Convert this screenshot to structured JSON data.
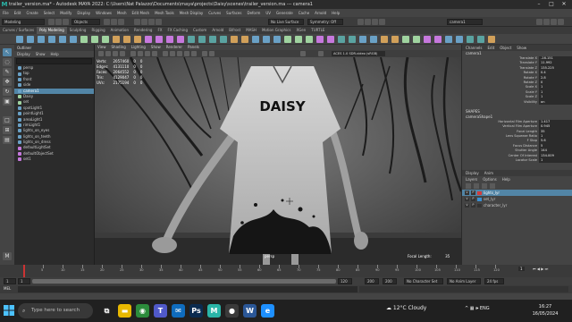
{
  "window": {
    "app_icon": "maya-icon",
    "title": "trailer_version.ma* - Autodesk MAYA 2022: C:\\Users\\Nat Palazzo\\Documents\\maya\\projects\\Daisy\\scenes\\trailer_version.ma  ---  camera1",
    "minimize": "–",
    "maximize": "□",
    "close": "✕"
  },
  "menubar": [
    "File",
    "Edit",
    "Create",
    "Select",
    "Modify",
    "Display",
    "Windows",
    "Mesh",
    "Edit Mesh",
    "Mesh Tools",
    "Mesh Display",
    "Curves",
    "Surfaces",
    "Deform",
    "UV",
    "Generate",
    "Cache",
    "Arnold",
    "Help"
  ],
  "statusline": {
    "mode": "Modeling",
    "objects": "Objects",
    "live_surface": "No Live Surface",
    "symmetry": "Symmetry: Off",
    "workspace_search": "camera1"
  },
  "shelf_tabs": [
    "Curves / Surfaces",
    "Poly Modeling",
    "Sculpting",
    "Rigging",
    "Animation",
    "Rendering",
    "FX",
    "FX Caching",
    "Custom",
    "Arnold",
    "Bifrost",
    "MASH",
    "Motion Graphics",
    "XGen",
    "TURTLE"
  ],
  "active_shelf_tab": 1,
  "outliner": {
    "title": "Outliner",
    "menu": [
      "Display",
      "Show",
      "Help"
    ],
    "items": [
      {
        "label": "persp",
        "type": "cam",
        "selected": false
      },
      {
        "label": "top",
        "type": "cam",
        "selected": false
      },
      {
        "label": "front",
        "type": "cam",
        "selected": false
      },
      {
        "label": "side",
        "type": "cam",
        "selected": false
      },
      {
        "label": "camera1",
        "type": "cam",
        "selected": true
      },
      {
        "label": "Daisy",
        "type": "mesh",
        "selected": false
      },
      {
        "label": "set",
        "type": "mesh",
        "selected": false
      },
      {
        "label": "spotLight1",
        "type": "cam",
        "selected": false
      },
      {
        "label": "pointLight1",
        "type": "cam",
        "selected": false
      },
      {
        "label": "areaLight1",
        "type": "cam",
        "selected": false
      },
      {
        "label": "rimLight1",
        "type": "cam",
        "selected": false
      },
      {
        "label": "lights_on_eyes",
        "type": "cam",
        "selected": false
      },
      {
        "label": "lights_on_teeth",
        "type": "cam",
        "selected": false
      },
      {
        "label": "lights_on_dress",
        "type": "cam",
        "selected": false
      },
      {
        "label": "defaultLightSet",
        "type": "set",
        "selected": false
      },
      {
        "label": "defaultObjectSet",
        "type": "set",
        "selected": false
      },
      {
        "label": "set1",
        "type": "set",
        "selected": false
      }
    ]
  },
  "viewport": {
    "menu": [
      "View",
      "Shading",
      "Lighting",
      "Show",
      "Renderer",
      "Panels"
    ],
    "hud": [
      {
        "label": "Verts:",
        "v1": "2057460",
        "v2": "0",
        "v3": "0"
      },
      {
        "label": "Edges:",
        "v1": "4131110",
        "v2": "0",
        "v3": "0"
      },
      {
        "label": "Faces:",
        "v1": "2064552",
        "v2": "0",
        "v3": "0"
      },
      {
        "label": "Tris:",
        "v1": "4129047",
        "v2": "0",
        "v3": "0"
      },
      {
        "label": "UVs:",
        "v1": "2175194",
        "v2": "0",
        "v3": "0"
      }
    ],
    "shirt_text": "DAISY",
    "camera_label": "persp",
    "focal_label": "Focal Length:",
    "focal_value": "35",
    "colorspace": "ACES 1.0 SDR-video (sRGB)"
  },
  "channelbox": {
    "tabs": [
      "Channels",
      "Edit",
      "Object",
      "Show"
    ],
    "node": "camera1",
    "attrs": [
      {
        "name": "Translate X",
        "value": "-16.151"
      },
      {
        "name": "Translate Y",
        "value": "11.992"
      },
      {
        "name": "Translate Z",
        "value": "135.225"
      },
      {
        "name": "Rotate X",
        "value": "0.4"
      },
      {
        "name": "Rotate Y",
        "value": "2.8"
      },
      {
        "name": "Rotate Z",
        "value": "0"
      },
      {
        "name": "Scale X",
        "value": "1"
      },
      {
        "name": "Scale Y",
        "value": "1"
      },
      {
        "name": "Scale Z",
        "value": "1"
      },
      {
        "name": "Visibility",
        "value": "on"
      }
    ],
    "shapes_header": "SHAPES",
    "shape_node": "cameraShape1",
    "shape_attrs": [
      {
        "name": "Horizontal Film Aperture",
        "value": "1.417"
      },
      {
        "name": "Vertical Film Aperture",
        "value": "0.945"
      },
      {
        "name": "Focal Length",
        "value": "35"
      },
      {
        "name": "Lens Squeeze Ratio",
        "value": "1"
      },
      {
        "name": "F Stop",
        "value": "5.6"
      },
      {
        "name": "Focus Distance",
        "value": "5"
      },
      {
        "name": "Shutter Angle",
        "value": "144"
      },
      {
        "name": "Center Of Interest",
        "value": "134.009"
      },
      {
        "name": "Locator Scale",
        "value": "1"
      }
    ],
    "layer_tabs": [
      "Display",
      "Anim"
    ],
    "layer_menu": [
      "Layers",
      "Options",
      "Help"
    ],
    "layers": [
      {
        "label": "lights_lyr",
        "color": "#d23b3b",
        "selected": true
      },
      {
        "label": "set_lyr",
        "color": "#3a8fd1",
        "selected": false
      },
      {
        "label": "character_lyr",
        "color": "#333333",
        "selected": false
      }
    ]
  },
  "timeline": {
    "ticks": [
      "5",
      "10",
      "15",
      "20",
      "25",
      "30",
      "35",
      "40",
      "45",
      "50",
      "55",
      "60",
      "65",
      "70",
      "75",
      "80",
      "85",
      "90",
      "95",
      "100",
      "105",
      "110",
      "115",
      "120"
    ],
    "current_frame": "1",
    "range_start": "1",
    "range_inner_start": "1",
    "range_inner_end": "120",
    "range_end": "120",
    "range_out": "200",
    "range_out2": "200",
    "character_set": "No Character Set",
    "anim_layer": "No Anim Layer",
    "fps": "24 fps"
  },
  "cmdline": {
    "label": "MEL"
  },
  "taskbar": {
    "search_placeholder": "Type here to search",
    "weather": "12°C  Cloudy",
    "lang": "ENG",
    "time": "16:27",
    "date": "16/05/2024",
    "app_icons": [
      {
        "name": "task-view-icon",
        "glyph": "⧉",
        "color": "#202020"
      },
      {
        "name": "file-explorer-icon",
        "glyph": "▬",
        "color": "#e8b800"
      },
      {
        "name": "chrome-icon",
        "glyph": "◉",
        "color": "#2c8c3c"
      },
      {
        "name": "teams-icon",
        "glyph": "T",
        "color": "#5059c9"
      },
      {
        "name": "mail-icon",
        "glyph": "✉",
        "color": "#0f6cbd"
      },
      {
        "name": "photoshop-icon",
        "glyph": "Ps",
        "color": "#0b2b4f"
      },
      {
        "name": "maya-taskbar-icon",
        "glyph": "M",
        "color": "#2ab5a8"
      },
      {
        "name": "obs-icon",
        "glyph": "●",
        "color": "#3a3a3a"
      },
      {
        "name": "word-icon",
        "glyph": "W",
        "color": "#2b5797"
      },
      {
        "name": "explorer-icon",
        "glyph": "e",
        "color": "#1e90ff"
      }
    ]
  }
}
